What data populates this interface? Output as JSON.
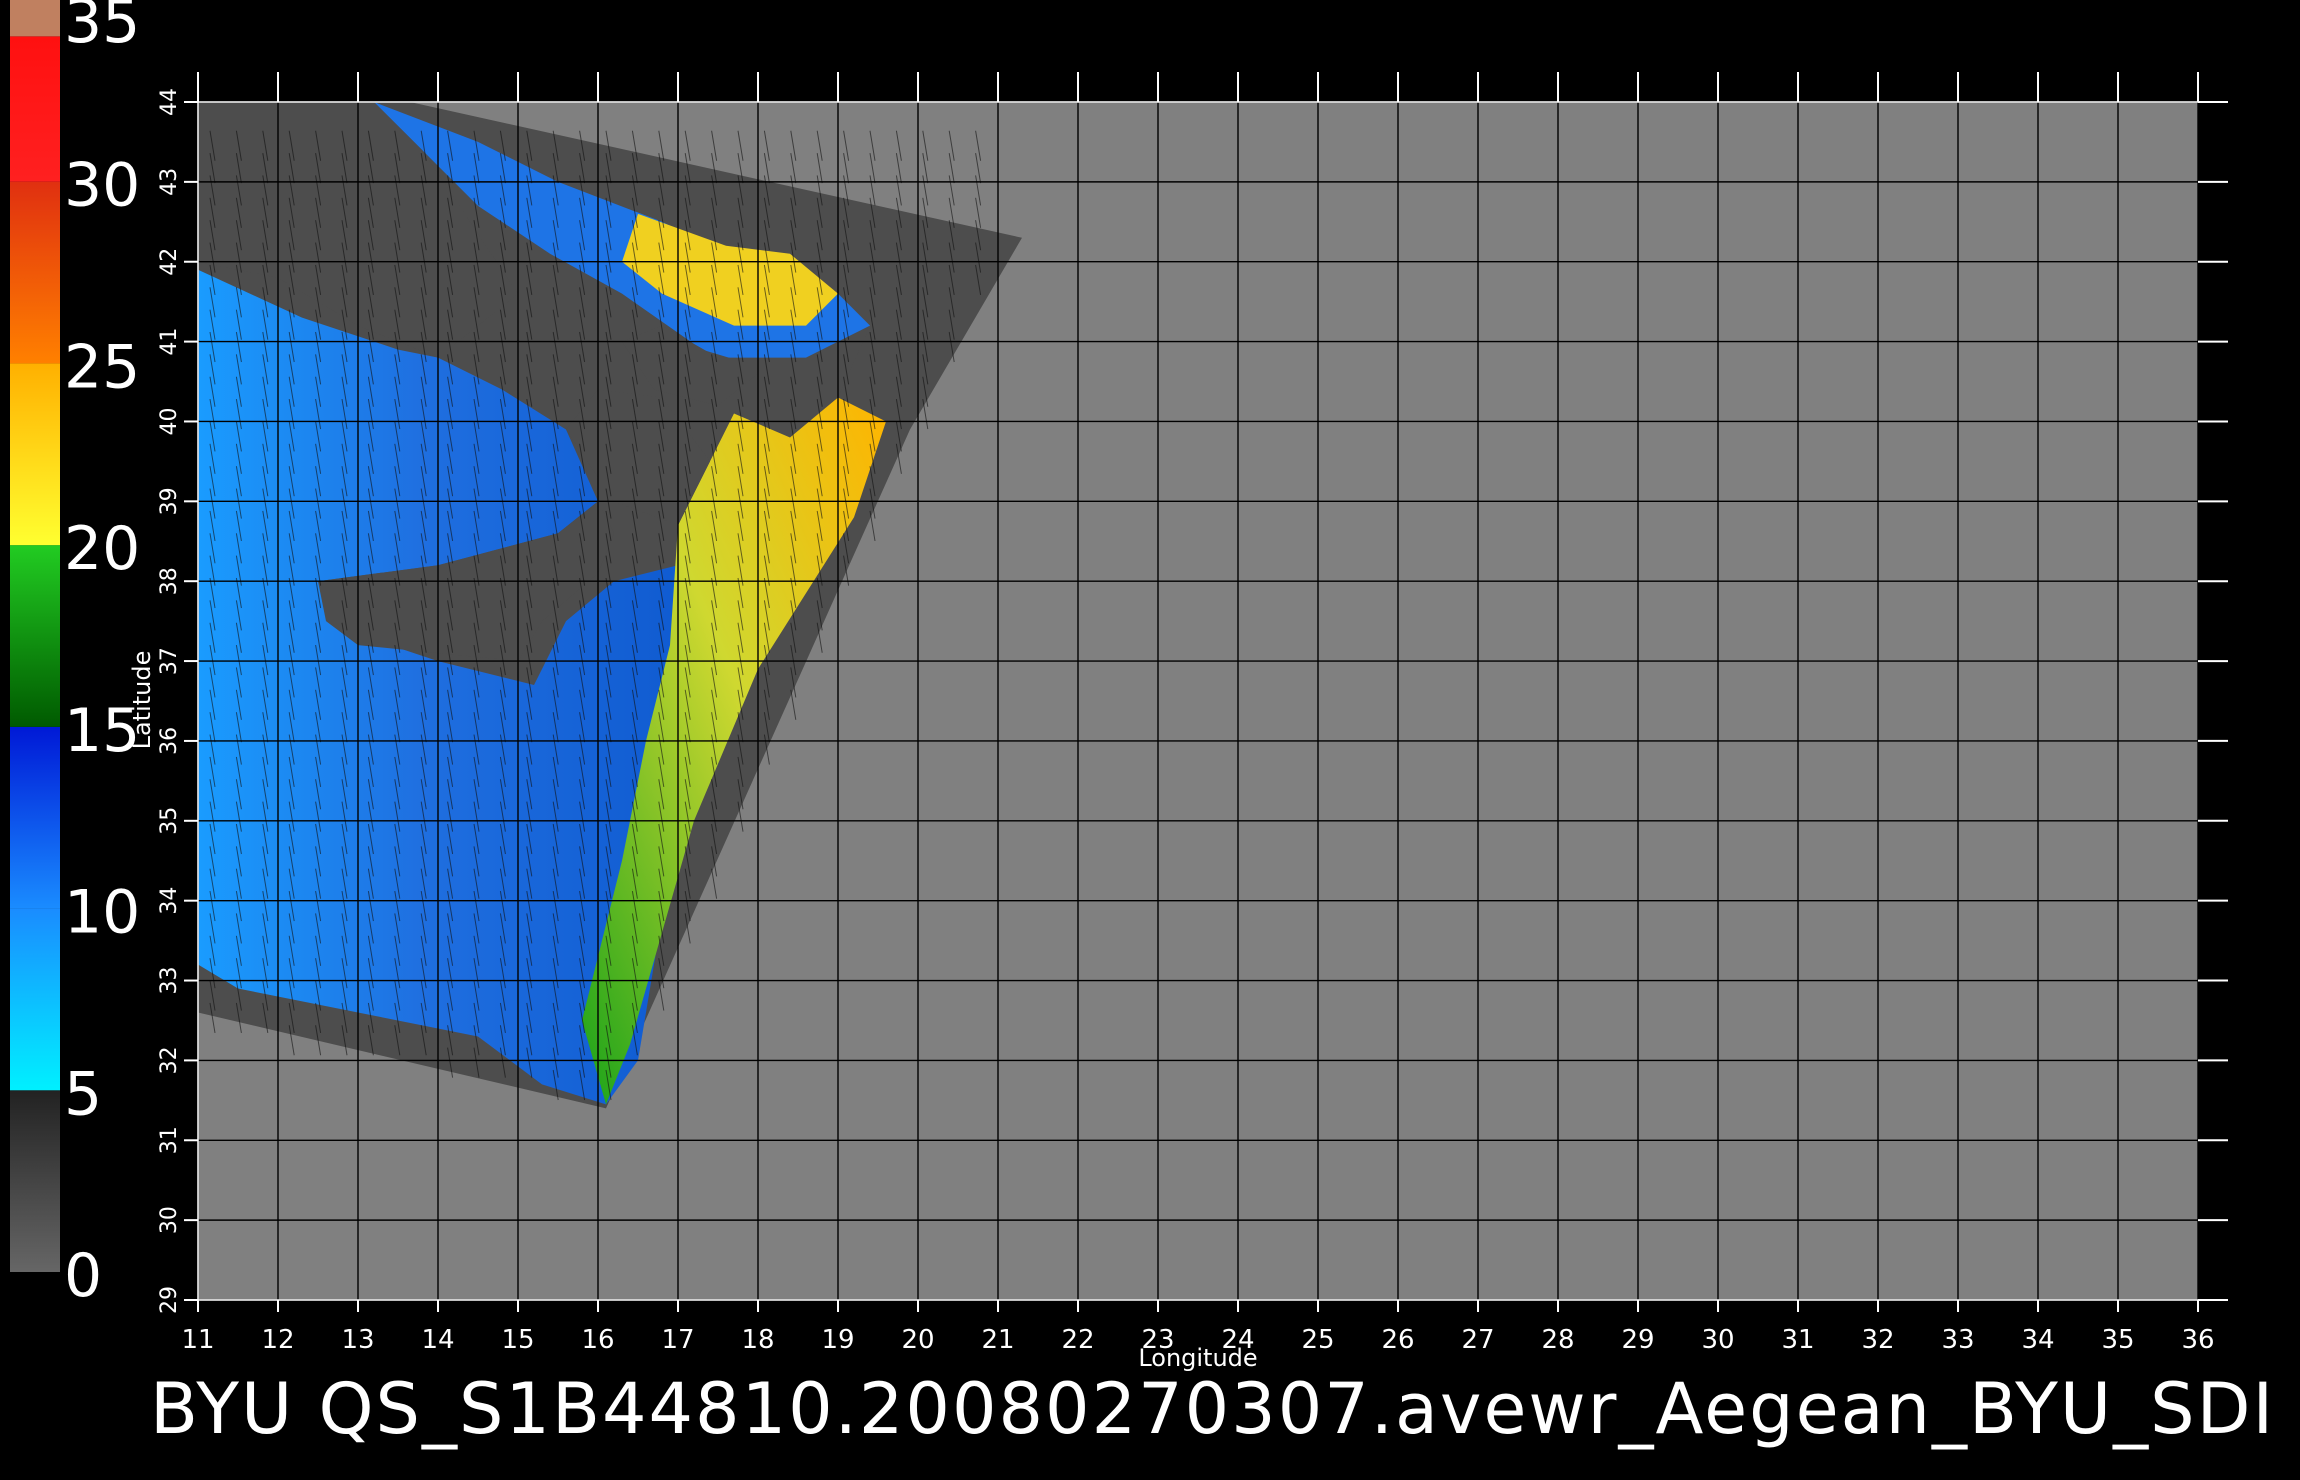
{
  "caption": "BYU QS_S1B44810.20080270307.avewr_Aegean_BYU_SDI",
  "chart_data": {
    "type": "heatmap",
    "title": "",
    "xlabel": "Longitude",
    "ylabel": "Latitude",
    "xlim": [
      11,
      36
    ],
    "ylim": [
      29,
      44
    ],
    "x_ticks": [
      11,
      12,
      13,
      14,
      15,
      16,
      17,
      18,
      19,
      20,
      21,
      22,
      23,
      24,
      25,
      26,
      27,
      28,
      29,
      30,
      31,
      32,
      33,
      34,
      35,
      36
    ],
    "y_ticks": [
      29,
      30,
      31,
      32,
      33,
      34,
      35,
      36,
      37,
      38,
      39,
      40,
      41,
      42,
      43,
      44
    ],
    "grid": true,
    "colorbar": {
      "ticks": [
        0,
        5,
        10,
        15,
        20,
        25,
        30,
        35
      ],
      "range": [
        0,
        35
      ],
      "bands": [
        {
          "from": 0,
          "to": 5,
          "color_start": "#666666",
          "color_end": "#222222"
        },
        {
          "from": 5,
          "to": 10,
          "color_start": "#00f0ff",
          "color_end": "#1a8cff"
        },
        {
          "from": 10,
          "to": 15,
          "color_start": "#1a8cff",
          "color_end": "#0019d6"
        },
        {
          "from": 15,
          "to": 20,
          "color_start": "#005a00",
          "color_end": "#22cc22"
        },
        {
          "from": 20,
          "to": 25,
          "color_start": "#ffff30",
          "color_end": "#ffb000"
        },
        {
          "from": 25,
          "to": 30,
          "color_start": "#ff8000",
          "color_end": "#e03010"
        },
        {
          "from": 30,
          "to": 34,
          "color_start": "#ff2020",
          "color_end": "#ff1010"
        },
        {
          "from": 34,
          "to": 35,
          "color_start": "#c08060",
          "color_end": "#c08060"
        }
      ]
    },
    "colors": {
      "no_data": "#808080",
      "swath_background": "#4d4d4d",
      "grid": "#000000"
    }
  }
}
